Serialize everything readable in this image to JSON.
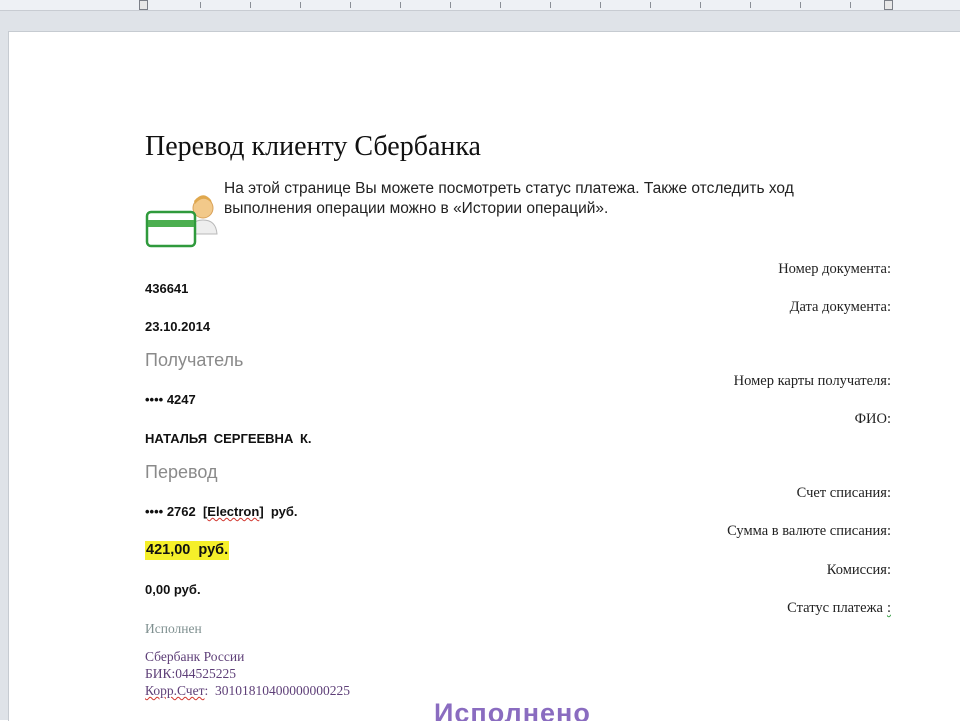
{
  "document": {
    "title": "Перевод клиенту Сбербанка",
    "intro": "На этой странице Вы можете посмотреть статус платежа. Также отследить ход выполнения операции можно в «Истории операций».",
    "icon": "card-with-person-icon",
    "fields": [
      {
        "label": "Номер документа:",
        "value": "436641"
      },
      {
        "label": "Дата документа:",
        "value": "23.10.2014"
      }
    ],
    "recipient": {
      "heading": "Получатель",
      "card_label": "Номер карты получателя:",
      "card_value": "•••• 4247",
      "name_label": "ФИО:",
      "name_value": "НАТАЛЬЯ СЕРГЕЕВНА К."
    },
    "transfer": {
      "heading": "Перевод",
      "account_label": "Счет списания:",
      "account_prefix": "•••• 2762  [",
      "account_card_type": "Electron",
      "account_suffix": "]  руб.",
      "amount_label": "Сумма в валюте списания:",
      "amount_value": "421,00  руб.",
      "fee_label": "Комиссия:",
      "fee_value": "0,00 руб.",
      "status_label": "Статус платежа",
      "status_colon": ":",
      "status_value": "Исполнен"
    },
    "bank": {
      "name": "Сбербанк России",
      "bik": "БИК:044525225",
      "corr_label": "Корр.Счет",
      "corr_value": ":  30101810400000000225"
    },
    "stamp_text": "Исполнено",
    "colors": {
      "highlight": "#f5ef2a",
      "bank_text": "#5e3f78",
      "stamp": "#8a6cc0",
      "section": "#8a8a8a"
    }
  }
}
